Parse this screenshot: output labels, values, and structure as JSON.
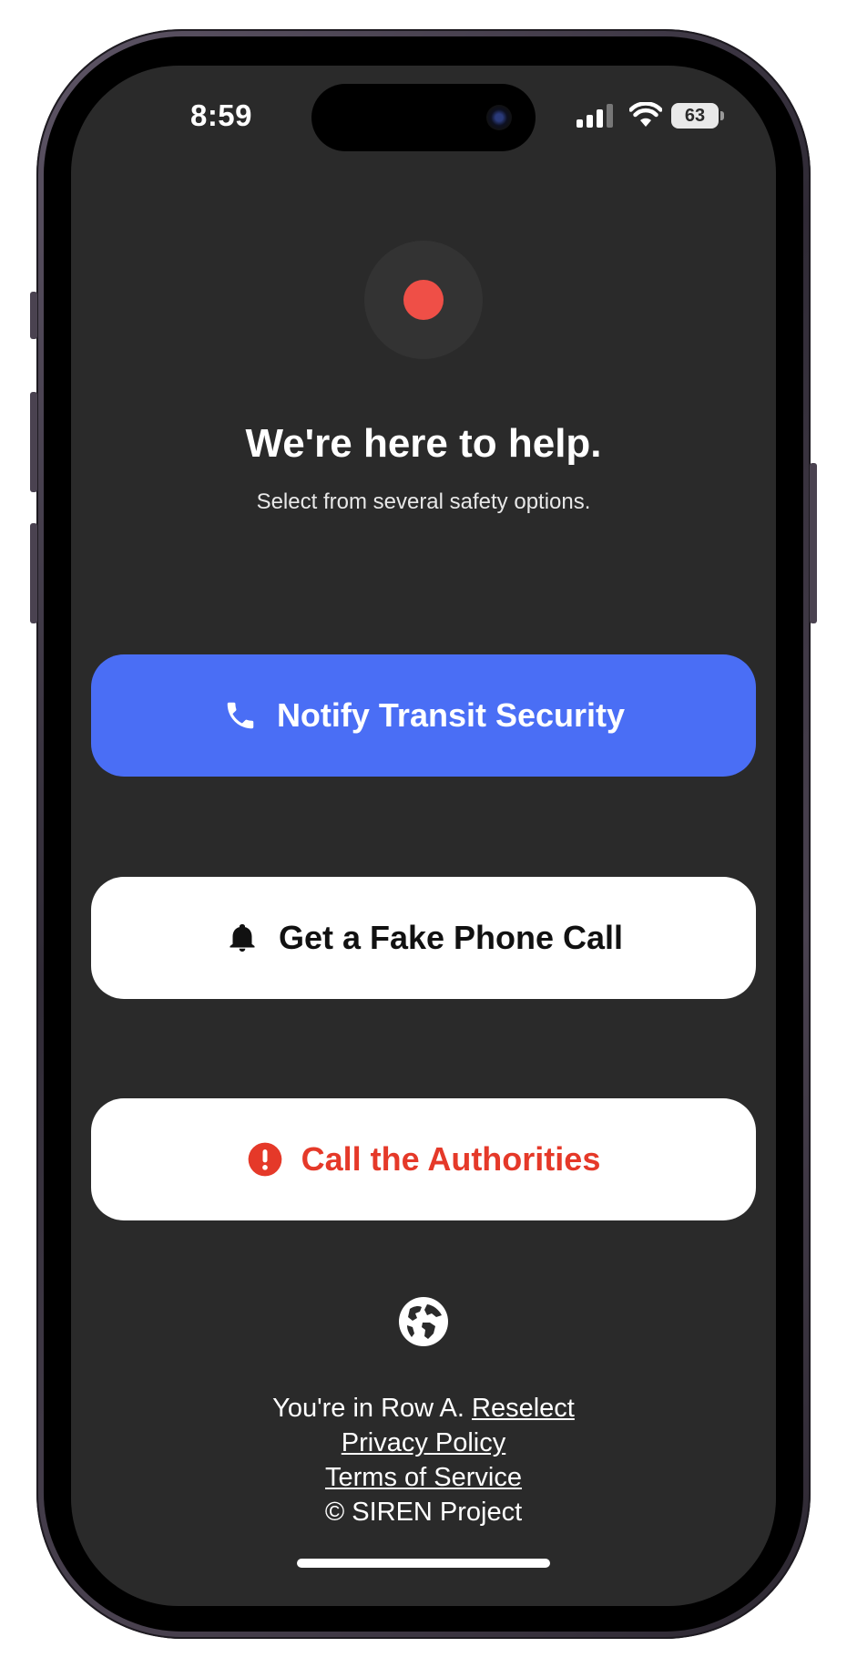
{
  "status_bar": {
    "time": "8:59",
    "battery": "63"
  },
  "hero": {
    "title": "We're here to help.",
    "subtitle": "Select from several safety options."
  },
  "actions": [
    {
      "label": "Notify Transit Security",
      "icon": "phone-icon",
      "color": "#4a6ef5"
    },
    {
      "label": "Get a Fake Phone Call",
      "icon": "bell-icon",
      "color": "#ffffff"
    },
    {
      "label": "Call the Authorities",
      "icon": "alert-icon",
      "color": "#e53929"
    }
  ],
  "footer": {
    "location_text": "You're in Row A.",
    "reselect_link": "Reselect",
    "privacy_link": "Privacy Policy",
    "terms_link": "Terms of Service",
    "copyright": "© SIREN Project"
  },
  "colors": {
    "background": "#2a2a2a",
    "recording_dot": "#ef4f47"
  }
}
